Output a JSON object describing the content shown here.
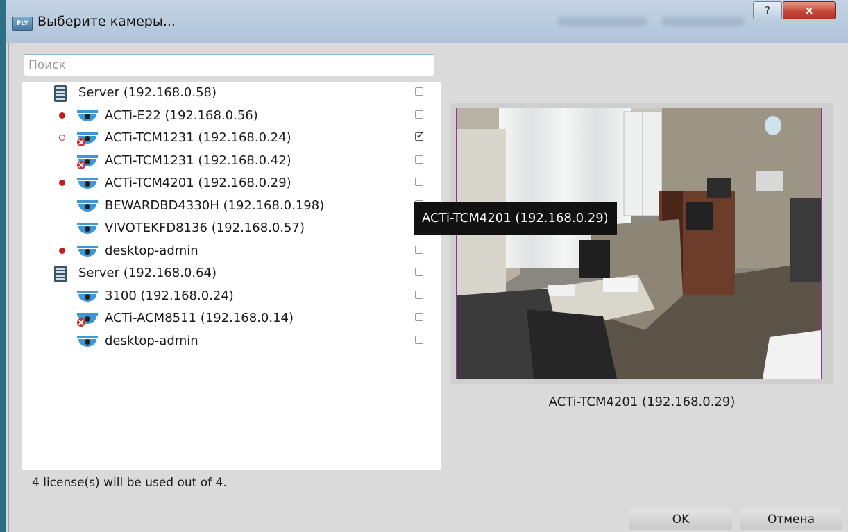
{
  "window": {
    "logo_text": "FLY",
    "title": "Выберите камеры...",
    "help_glyph": "?",
    "close_glyph": "x"
  },
  "search": {
    "placeholder": "Поиск",
    "value": ""
  },
  "tree": {
    "items": [
      {
        "label": "Server (192.168.0.58)",
        "type": "server",
        "status": "none",
        "checked": false,
        "indent": 1
      },
      {
        "label": "ACTi-E22 (192.168.0.56)",
        "type": "camera",
        "status": "recording",
        "checked": false,
        "indent": 2
      },
      {
        "label": "ACTi-TCM1231 (192.168.0.24)",
        "type": "camera-error",
        "status": "recording-off",
        "checked": true,
        "indent": 2
      },
      {
        "label": "ACTi-TCM1231 (192.168.0.42)",
        "type": "camera-error",
        "status": "none",
        "checked": false,
        "indent": 2
      },
      {
        "label": "ACTi-TCM4201 (192.168.0.29)",
        "type": "camera",
        "status": "recording",
        "checked": false,
        "indent": 2
      },
      {
        "label": "BEWARDBD4330H (192.168.0.198)",
        "type": "camera",
        "status": "none",
        "checked": false,
        "indent": 2
      },
      {
        "label": "VIVOTEKFD8136 (192.168.0.57)",
        "type": "camera",
        "status": "none",
        "checked": false,
        "indent": 2
      },
      {
        "label": "desktop-admin",
        "type": "camera",
        "status": "recording",
        "checked": false,
        "indent": 2
      },
      {
        "label": "Server (192.168.0.64)",
        "type": "server",
        "status": "none",
        "checked": false,
        "indent": 1
      },
      {
        "label": "3100 (192.168.0.24)",
        "type": "camera",
        "status": "none",
        "checked": false,
        "indent": 2
      },
      {
        "label": "ACTi-ACM8511 (192.168.0.14)",
        "type": "camera-error",
        "status": "none",
        "checked": false,
        "indent": 2
      },
      {
        "label": "desktop-admin",
        "type": "camera",
        "status": "none",
        "checked": false,
        "indent": 2
      }
    ]
  },
  "tooltip": {
    "text": "ACTi-TCM4201 (192.168.0.29)"
  },
  "preview": {
    "caption": "ACTi-TCM4201 (192.168.0.29)"
  },
  "license_text": "4 license(s) will be used out of 4.",
  "buttons": {
    "ok": "OK",
    "cancel": "Отмена"
  },
  "colors": {
    "recording_dot": "#c11d1d",
    "camera_icon": "#3f97d6",
    "error_badge": "#d32a2a",
    "server_icon": "#3c5566"
  }
}
